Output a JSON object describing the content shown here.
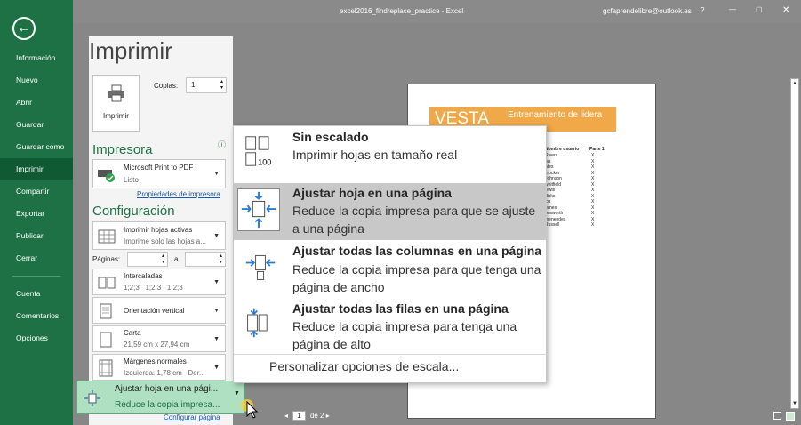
{
  "window": {
    "title": "excel2016_findreplace_practice - Excel",
    "user": "gcfaprendelibre@outlook.es",
    "help": "?",
    "minimize": "—",
    "restore": "▢",
    "close": "✕"
  },
  "sidebar": {
    "items": [
      "Información",
      "Nuevo",
      "Abrir",
      "Guardar",
      "Guardar como",
      "Imprimir",
      "Compartir",
      "Exportar",
      "Publicar",
      "Cerrar",
      "Cuenta",
      "Comentarios",
      "Opciones"
    ]
  },
  "print": {
    "title": "Imprimir",
    "copies_label": "Copias:",
    "copies_value": "1",
    "print_button": "Imprimir",
    "printer_section": "Impresora",
    "printer_name": "Microsoft Print to PDF",
    "printer_status": "Listo",
    "printer_props": "Propiedades de impresora",
    "config_section": "Configuración",
    "sheets_main": "Imprimir hojas activas",
    "sheets_sub": "Imprime solo las hojas a...",
    "pages_label": "Páginas:",
    "pages_to": "a",
    "collate_main": "Intercaladas",
    "collate_sub": "1;2;3   1;2;3   1;2;3",
    "orientation": "Orientación vertical",
    "paper_main": "Carta",
    "paper_sub": "21,59 cm x 27,94 cm",
    "margins_main": "Márgenes normales",
    "margins_sub": "Izquierda: 1,78 cm   Der...",
    "scale_main": "Ajustar hoja en una pági...",
    "scale_sub": "Reduce la copia impresa...",
    "config_page": "Configurar página"
  },
  "scaling_menu": {
    "options": [
      {
        "title": "Sin escalado",
        "desc": "Imprimir hojas en tamaño real",
        "icon": "no-scaling-icon"
      },
      {
        "title": "Ajustar hoja en una página",
        "desc": "Reduce la copia impresa para que se ajuste a una página",
        "icon": "fit-sheet-icon"
      },
      {
        "title": "Ajustar todas las columnas en una página",
        "desc": "Reduce la copia impresa para que tenga una página de ancho",
        "icon": "fit-columns-icon"
      },
      {
        "title": "Ajustar todas las filas en una página",
        "desc": "Reduce la copia impresa para tenga una página de alto",
        "icon": "fit-rows-icon"
      }
    ],
    "custom": "Personalizar opciones de escala...",
    "icon_100": "100"
  },
  "preview": {
    "brand": "VESTA",
    "heading": "Entrenamiento de lidera",
    "col1": "Nombre usuario",
    "col2": "Parte 1",
    "rows": [
      "Rivera",
      "ias",
      "ates",
      "crocker",
      "Johnson",
      "whitfield",
      "lewis",
      "dicks",
      "ios",
      "jaines",
      "bosworth",
      "menendes",
      "Russell"
    ],
    "mark": "X"
  },
  "pager": {
    "current": "1",
    "of": "de 2"
  },
  "colors": {
    "accent": "#1e7145",
    "highlight": "#c8c8c8",
    "preview_orange": "#f0a848"
  }
}
